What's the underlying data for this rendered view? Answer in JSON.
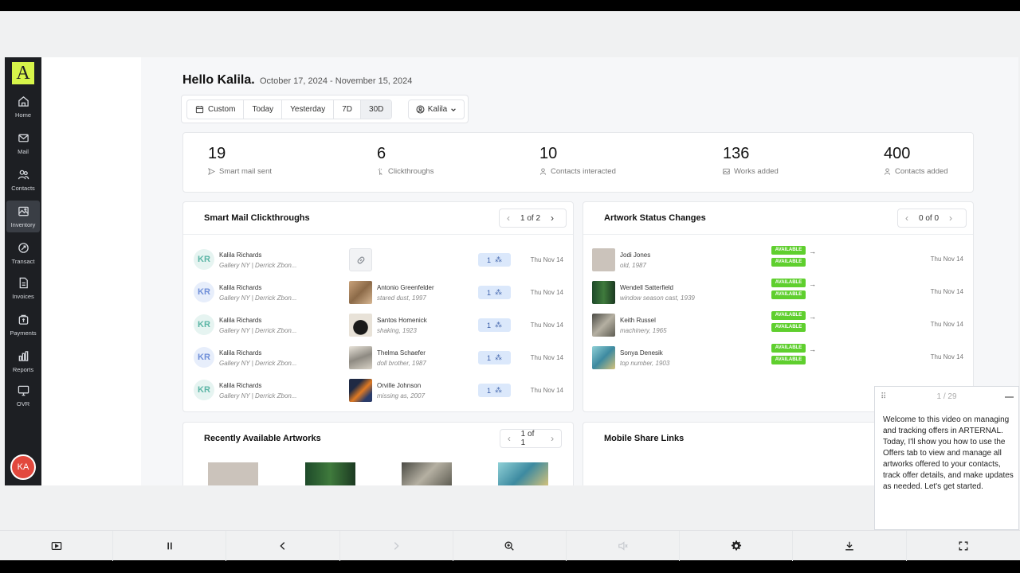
{
  "sidebar": {
    "logo": "A",
    "items": [
      {
        "label": "Home",
        "icon": "home-icon"
      },
      {
        "label": "Mail",
        "icon": "mail-icon"
      },
      {
        "label": "Contacts",
        "icon": "contacts-icon"
      },
      {
        "label": "Inventory",
        "icon": "inventory-icon"
      },
      {
        "label": "Transact",
        "icon": "transact-icon"
      },
      {
        "label": "Invoices",
        "icon": "invoices-icon"
      },
      {
        "label": "Payments",
        "icon": "payments-icon"
      },
      {
        "label": "Reports",
        "icon": "reports-icon"
      },
      {
        "label": "OVR",
        "icon": "ovr-icon"
      }
    ],
    "user_initials": "KA"
  },
  "header": {
    "greeting": "Hello Kalila.",
    "date_range": "October 17, 2024 - November 15, 2024"
  },
  "filters": {
    "ranges": [
      "Custom",
      "Today",
      "Yesterday",
      "7D",
      "30D"
    ],
    "selected_range": "30D",
    "user": "Kalila"
  },
  "stats": [
    {
      "value": "19",
      "label": "Smart mail sent"
    },
    {
      "value": "6",
      "label": "Clickthroughs"
    },
    {
      "value": "10",
      "label": "Contacts interacted"
    },
    {
      "value": "136",
      "label": "Works added"
    },
    {
      "value": "400",
      "label": "Contacts added"
    }
  ],
  "clickthroughs": {
    "title": "Smart Mail Clickthroughs",
    "pager": "1 of 2",
    "rows": [
      {
        "initials": "KR",
        "name": "Kalila Richards",
        "sub": "Gallery NY | Derrick Zbon...",
        "artwork": "",
        "artwork_sub": "",
        "count": "1",
        "date": "Thu Nov 14"
      },
      {
        "initials": "KR",
        "name": "Kalila Richards",
        "sub": "Gallery NY | Derrick Zbon...",
        "artwork": "Antonio Greenfelder",
        "artwork_sub": "stared dust, 1997",
        "count": "1",
        "date": "Thu Nov 14"
      },
      {
        "initials": "KR",
        "name": "Kalila Richards",
        "sub": "Gallery NY | Derrick Zbon...",
        "artwork": "Santos Homenick",
        "artwork_sub": "shaking, 1923",
        "count": "1",
        "date": "Thu Nov 14"
      },
      {
        "initials": "KR",
        "name": "Kalila Richards",
        "sub": "Gallery NY | Derrick Zbon...",
        "artwork": "Thelma Schaefer",
        "artwork_sub": "doll brother, 1987",
        "count": "1",
        "date": "Thu Nov 14"
      },
      {
        "initials": "KR",
        "name": "Kalila Richards",
        "sub": "Gallery NY | Derrick Zbon...",
        "artwork": "Orville Johnson",
        "artwork_sub": "missing as, 2007",
        "count": "1",
        "date": "Thu Nov 14"
      }
    ]
  },
  "status_changes": {
    "title": "Artwork Status Changes",
    "pager": "0 of 0",
    "rows": [
      {
        "name": "Jodi Jones",
        "sub": "old, 1987",
        "from": "AVAILABLE",
        "to": "AVAILABLE",
        "date": "Thu Nov 14"
      },
      {
        "name": "Wendell Satterfield",
        "sub": "window season cast, 1939",
        "from": "AVAILABLE",
        "to": "AVAILABLE",
        "date": "Thu Nov 14"
      },
      {
        "name": "Keith Russel",
        "sub": "machinery, 1965",
        "from": "AVAILABLE",
        "to": "AVAILABLE",
        "date": "Thu Nov 14"
      },
      {
        "name": "Sonya Denesik",
        "sub": "top number, 1903",
        "from": "AVAILABLE",
        "to": "AVAILABLE",
        "date": "Thu Nov 14"
      }
    ]
  },
  "recent": {
    "title": "Recently Available Artworks",
    "pager": "1 of 1"
  },
  "mobile": {
    "title": "Mobile Share Links"
  },
  "caption": {
    "count": "1 / 29",
    "text": "Welcome to this video on managing and tracking offers in ARTERNAL. Today, I'll show you how to use the Offers tab to view and manage all artworks offered to your contacts, track offer details, and make updates as needed. Let's get started."
  },
  "player": {
    "buttons": [
      "playlist-icon",
      "pause-icon",
      "previous-icon",
      "next-icon",
      "zoom-icon",
      "mute-icon",
      "settings-icon",
      "download-icon",
      "fullscreen-icon"
    ]
  },
  "colors": {
    "sidebar": "#1d1f23",
    "logo": "#d7f54a",
    "available": "#5fcf2e",
    "count_badge": "#dbe8fb",
    "avatar": "#e2483d"
  }
}
